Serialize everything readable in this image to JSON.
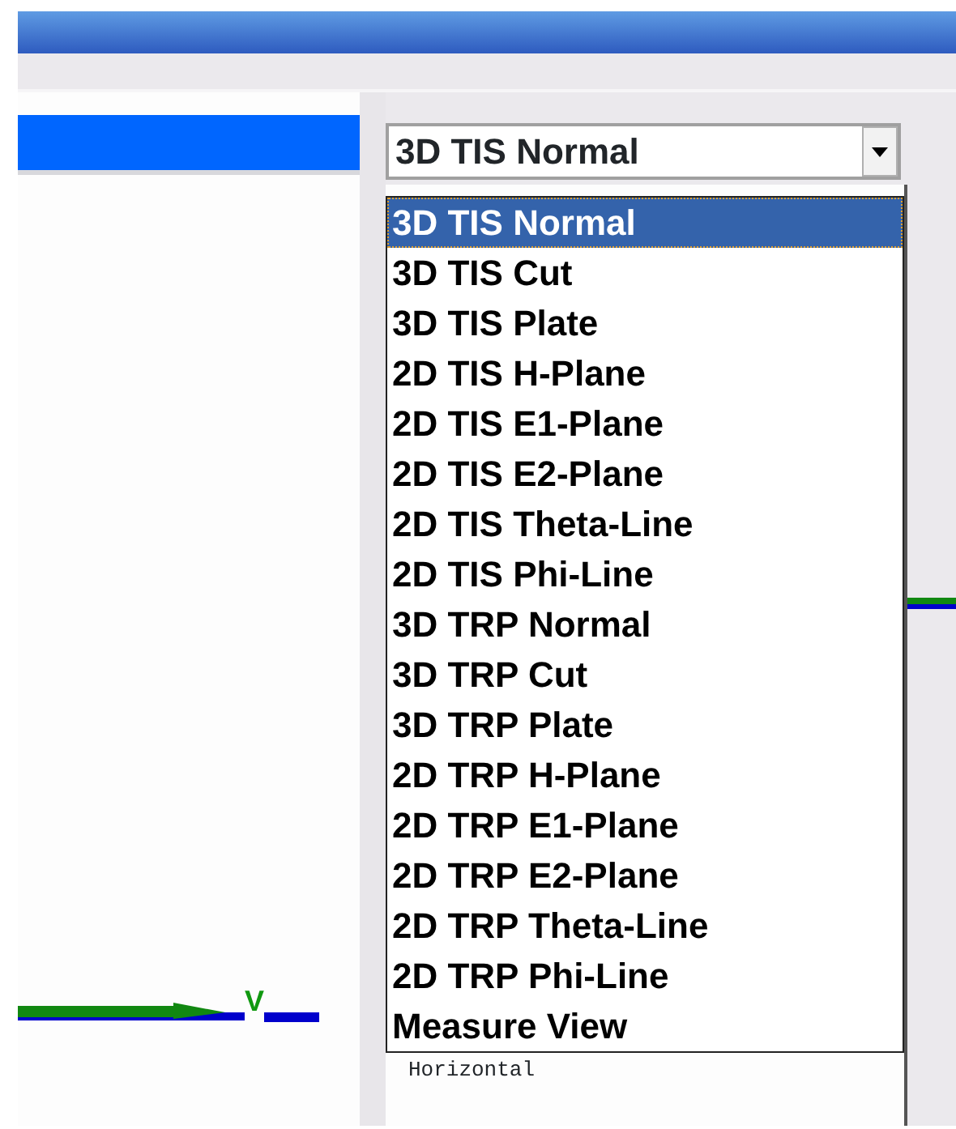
{
  "view_select": {
    "value": "3D TIS Normal",
    "expanded": true,
    "options": [
      {
        "label": "3D TIS Normal",
        "selected": true
      },
      {
        "label": "3D TIS Cut",
        "selected": false
      },
      {
        "label": "3D TIS Plate",
        "selected": false
      },
      {
        "label": "2D TIS H-Plane",
        "selected": false
      },
      {
        "label": "2D TIS E1-Plane",
        "selected": false
      },
      {
        "label": "2D TIS E2-Plane",
        "selected": false
      },
      {
        "label": "2D TIS Theta-Line",
        "selected": false
      },
      {
        "label": "2D TIS Phi-Line",
        "selected": false
      },
      {
        "label": "3D TRP Normal",
        "selected": false
      },
      {
        "label": "3D TRP Cut",
        "selected": false
      },
      {
        "label": "3D TRP Plate",
        "selected": false
      },
      {
        "label": "2D TRP H-Plane",
        "selected": false
      },
      {
        "label": "2D TRP E1-Plane",
        "selected": false
      },
      {
        "label": "2D TRP E2-Plane",
        "selected": false
      },
      {
        "label": "2D TRP Theta-Line",
        "selected": false
      },
      {
        "label": "2D TRP Phi-Line",
        "selected": false
      },
      {
        "label": "Measure View",
        "selected": false
      }
    ]
  },
  "plot_panel": {
    "axis_label": "V"
  },
  "detail_panel": {
    "label": "Horizontal"
  }
}
